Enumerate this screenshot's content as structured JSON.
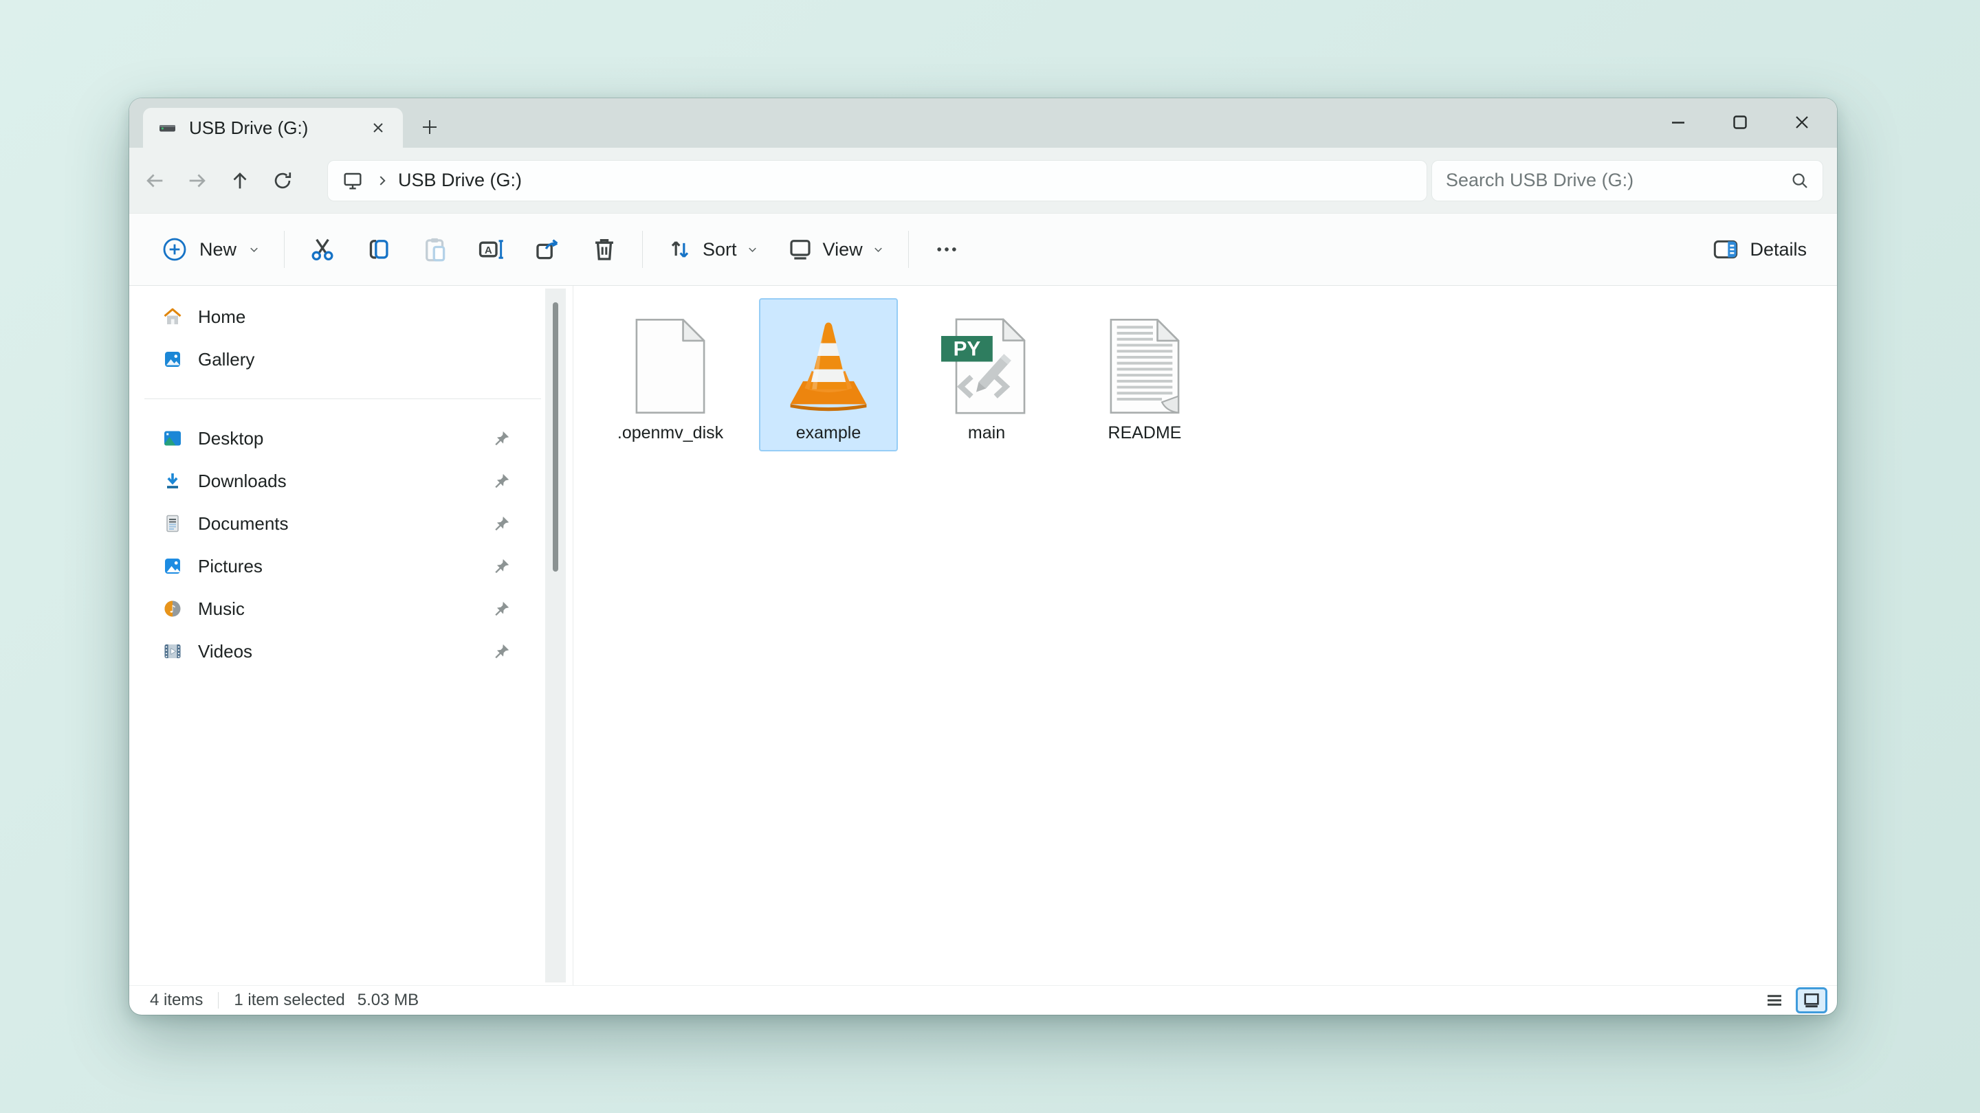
{
  "window": {
    "tab": {
      "title": "USB Drive (G:)"
    }
  },
  "navbar": {
    "breadcrumb": {
      "location": "USB Drive (G:)"
    },
    "search": {
      "placeholder": "Search USB Drive (G:)"
    }
  },
  "toolbar": {
    "new_label": "New",
    "sort_label": "Sort",
    "view_label": "View",
    "details_label": "Details"
  },
  "sidebar": {
    "items": [
      {
        "label": "Home",
        "icon": "home-icon",
        "pinned": false
      },
      {
        "label": "Gallery",
        "icon": "gallery-icon",
        "pinned": false
      },
      {
        "label": "Desktop",
        "icon": "desktop-icon",
        "pinned": true
      },
      {
        "label": "Downloads",
        "icon": "downloads-icon",
        "pinned": true
      },
      {
        "label": "Documents",
        "icon": "documents-icon",
        "pinned": true
      },
      {
        "label": "Pictures",
        "icon": "pictures-icon",
        "pinned": true
      },
      {
        "label": "Music",
        "icon": "music-icon",
        "pinned": true
      },
      {
        "label": "Videos",
        "icon": "videos-icon",
        "pinned": true
      }
    ]
  },
  "files": [
    {
      "name": ".openmv_disk",
      "icon": "blank-document-icon",
      "selected": false
    },
    {
      "name": "example",
      "icon": "vlc-cone-icon",
      "selected": true
    },
    {
      "name": "main",
      "icon": "python-file-icon",
      "selected": false
    },
    {
      "name": "README",
      "icon": "text-document-icon",
      "selected": false
    }
  ],
  "statusbar": {
    "items_count": "4 items",
    "selection": "1 item selected",
    "selection_size": "5.03 MB"
  },
  "colors": {
    "accent_blue": "#1673c6",
    "selection_fill": "#cce8ff",
    "selection_border": "#96cdf6",
    "mica_titlebar": "#d4dddc",
    "py_badge_green": "#2e7d5f",
    "vlc_orange": "#ef8c10",
    "desktop_background": "#d8ece8"
  }
}
